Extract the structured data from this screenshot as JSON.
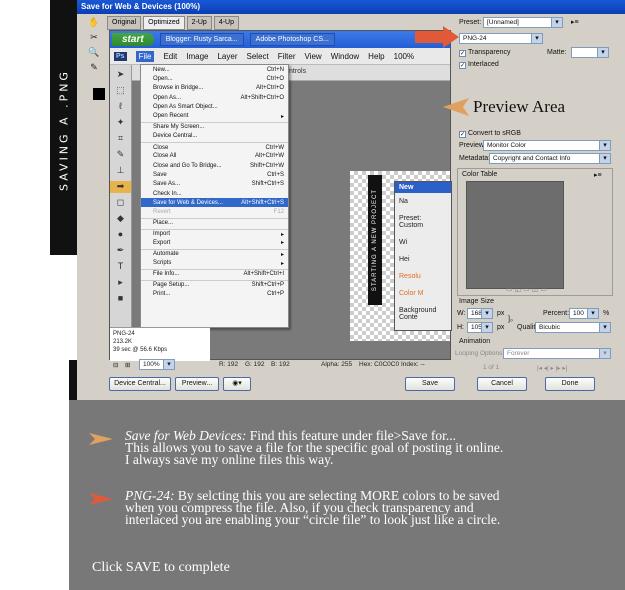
{
  "side_label": "SAVING A .PNG",
  "window": {
    "title": "Save for Web & Devices (100%)",
    "tabs": [
      "Original",
      "Optimized",
      "2-Up",
      "4-Up"
    ]
  },
  "taskbar": {
    "start": "start",
    "items": [
      "Blogger: Rusty Sarca...",
      "Adobe Photoshop CS..."
    ]
  },
  "ps": {
    "logo": "Ps",
    "menus": [
      "File",
      "Edit",
      "Image",
      "Layer",
      "Select",
      "Filter",
      "View",
      "Window",
      "Help"
    ],
    "options_text": "Controls",
    "zoom": "100%"
  },
  "file_menu": [
    {
      "label": "New...",
      "shortcut": "Ctrl+N"
    },
    {
      "label": "Open...",
      "shortcut": "Ctrl+O"
    },
    {
      "label": "Browse in Bridge...",
      "shortcut": "Alt+Ctrl+O"
    },
    {
      "label": "Open As...",
      "shortcut": "Alt+Shift+Ctrl+O"
    },
    {
      "label": "Open As Smart Object...",
      "shortcut": ""
    },
    {
      "label": "Open Recent",
      "shortcut": "▸"
    },
    {
      "label": "Share My Screen...",
      "shortcut": "",
      "sep": true
    },
    {
      "label": "Device Central...",
      "shortcut": ""
    },
    {
      "label": "Close",
      "shortcut": "Ctrl+W",
      "sep": true
    },
    {
      "label": "Close All",
      "shortcut": "Alt+Ctrl+W"
    },
    {
      "label": "Close and Go To Bridge...",
      "shortcut": "Shift+Ctrl+W"
    },
    {
      "label": "Save",
      "shortcut": "Ctrl+S"
    },
    {
      "label": "Save As...",
      "shortcut": "Shift+Ctrl+S"
    },
    {
      "label": "Check In...",
      "shortcut": ""
    },
    {
      "label": "Save for Web & Devices...",
      "shortcut": "Alt+Shift+Ctrl+S",
      "highlight": true
    },
    {
      "label": "Revert",
      "shortcut": "F12",
      "dim": true
    },
    {
      "label": "Place...",
      "shortcut": "",
      "sep": true
    },
    {
      "label": "Import",
      "shortcut": "▸",
      "sep": true
    },
    {
      "label": "Export",
      "shortcut": "▸"
    },
    {
      "label": "Automate",
      "shortcut": "▸",
      "sep": true
    },
    {
      "label": "Scripts",
      "shortcut": "▸"
    },
    {
      "label": "File Info...",
      "shortcut": "Alt+Shift+Ctrl+I",
      "sep": true
    },
    {
      "label": "Page Setup...",
      "shortcut": "Shift+Ctrl+P",
      "sep": true
    },
    {
      "label": "Print...",
      "shortcut": "Ctrl+P"
    }
  ],
  "canvas": {
    "strip_text": "STARTING A NEW PROJECT",
    "dialog_title": "New",
    "dialog_rows": [
      "Na",
      "Preset: Custom",
      "Wi",
      "Hei",
      "Resolu",
      "Color M",
      "Background Conte"
    ]
  },
  "ps_status": {
    "lines": [
      "PNG-24",
      "213.2K",
      "39 sec @ 56.6 Kbps"
    ]
  },
  "bottombar": {
    "zoom": "100%",
    "r": "R: 192",
    "g": "G: 192",
    "b": "B: 192",
    "alpha": "Alpha: 255",
    "hex": "Hex: C0C0C0",
    "index": "Index: --"
  },
  "settings": {
    "preset_label": "Preset:",
    "preset_value": "[Unnamed]",
    "format_value": "PNG-24",
    "transparency": "Transparency",
    "interlaced": "Interlaced",
    "matte_label": "Matte:",
    "convert_srgb": "Convert to sRGB",
    "preview_label": "Preview:",
    "preview_value": "Monitor Color",
    "metadata_label": "Metadata:",
    "metadata_value": "Copyright and Contact Info",
    "color_table": "Color Table",
    "image_size": "Image Size",
    "w_label": "W:",
    "w_value": "1680",
    "w_unit": "px",
    "h_label": "H:",
    "h_value": "1050",
    "h_unit": "px",
    "percent_label": "Percent:",
    "percent_value": "100",
    "percent_unit": "%",
    "quality_label": "Quality:",
    "quality_value": "Bicubic",
    "animation": "Animation",
    "looping_label": "Looping Options:",
    "looping_value": "Forever",
    "frame_counter": "1 of 1"
  },
  "preview_area_label": "Preview Area",
  "buttons": {
    "device_central": "Device Central...",
    "preview": "Preview...",
    "save": "Save",
    "cancel": "Cancel",
    "done": "Done"
  },
  "description": {
    "sfw_title": "Save for Web Devices:",
    "sfw_line1": " Find this feature under file>Save for...",
    "sfw_line2": "This allows you to save a file for the specific goal of posting it online.",
    "sfw_line3": "I always save my online files this way.",
    "png_title": "PNG-24:",
    "png_line1": " By selcting this you are selecting MORE colors to be saved",
    "png_line2": "when you compress the file. Also, if you check transparency and",
    "png_line3": "interlaced you are enabling your “circle file” to look just like a circle.",
    "click_save": "Click SAVE to complete"
  },
  "colors": {
    "accent_orange": "#e0a060",
    "arrow_red": "#e05a3a",
    "desc_bg": "#787878"
  }
}
